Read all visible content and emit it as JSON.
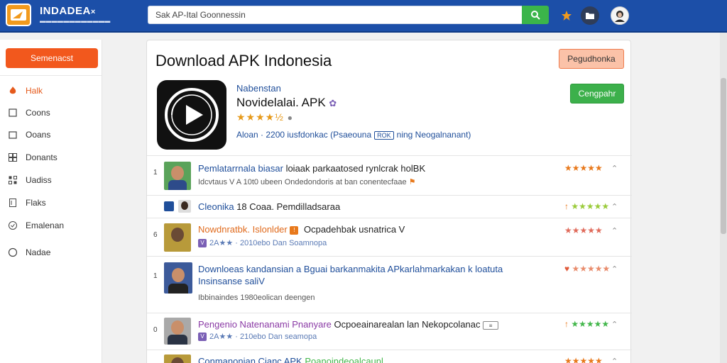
{
  "header": {
    "brand": "INDADEA",
    "brand_suffix": "×",
    "brand_sub": "▬▬▬▬▬▬▬▬▬▬▬▬",
    "search_value": "",
    "search_placeholder": "Sak AP-Ital Goonnessin",
    "accent": "#1c4fa8"
  },
  "sidebar": {
    "button_label": "Semenacst",
    "items": [
      {
        "label": "Halk",
        "icon": "flame-icon",
        "active": true
      },
      {
        "label": "Coons",
        "icon": "square-icon",
        "active": false
      },
      {
        "label": "Ooans",
        "icon": "square-icon",
        "active": false
      },
      {
        "label": "Donants",
        "icon": "grid-icon",
        "active": false
      },
      {
        "label": "Uadiss",
        "icon": "apps-icon",
        "active": false
      },
      {
        "label": "Flaks",
        "icon": "document-icon",
        "active": false
      },
      {
        "label": "Emalenan",
        "icon": "check-circle-icon",
        "active": false
      },
      {
        "label": "Nadae",
        "icon": "circle-icon",
        "active": false
      }
    ]
  },
  "main": {
    "title": "Download APK Indonesia",
    "top_button": "Pegudhonka",
    "app": {
      "developer": "Nabenstan",
      "name": "Novidelalai. APK",
      "rating_stars": "★★★★½",
      "meta_prefix": "Aloan · 2200 iusfdonkac (Psaeouna",
      "meta_tag": "ROK",
      "meta_suffix": "ning Neogalnanant)",
      "install_label": "Cengpahr"
    },
    "rows": [
      {
        "num": "1",
        "title_blue": "Pemlatarrnala biasar",
        "title_dark": " loiaak parkaatosed rynlcrak holBK",
        "sub": "Idcvtaus V A 10t0 ubeen Ondedondoris at ban conentecfaae",
        "stars": "★★★★★",
        "star_color": "#e8791c"
      },
      {
        "num": "",
        "title_blue": "Cleonika",
        "title_dark": "  18  Coaa. Pemdilladsaraa",
        "sub": "",
        "stars": "★★★★★",
        "star_color": "#9acb3a",
        "lead": "↑"
      },
      {
        "num": "6",
        "title_blue": "Nowdnratbk. Islonlder",
        "title_dark": "  Ocpadehbak usnatrica  V",
        "sub": "2A★★ · 2010ebo Dan Soamnopa",
        "stars": "★★★★★",
        "star_color": "#e06a5a"
      },
      {
        "num": "1",
        "title_blue": "Downloeas kandansian a Bguai barkanmakita APkarlahmarkakan k loatuta",
        "title_dark": "",
        "title_line2": "Insinsanse saliV",
        "sub": "Ibbinaindes  1980eolican deengen",
        "stars": "★★★★★",
        "star_color": "#e98c6c",
        "lead": "♥"
      },
      {
        "num": "0",
        "title_blue": "Pengenio  Natenanami  Pnanyare",
        "title_dark": "  Ocpoeainarealan lan Nekopcolanac",
        "sub": "2A★★ · 210ebo Dan seamopa",
        "stars": "★★★★★",
        "star_color": "#43b74b",
        "lead": "↑"
      },
      {
        "num": "",
        "title_blue": "Conmanonian Cianc APK",
        "title_dark": " Poanoindeoalcaunl",
        "sub": "",
        "stars": "★★★★★",
        "star_color": "#e8791c"
      }
    ]
  }
}
